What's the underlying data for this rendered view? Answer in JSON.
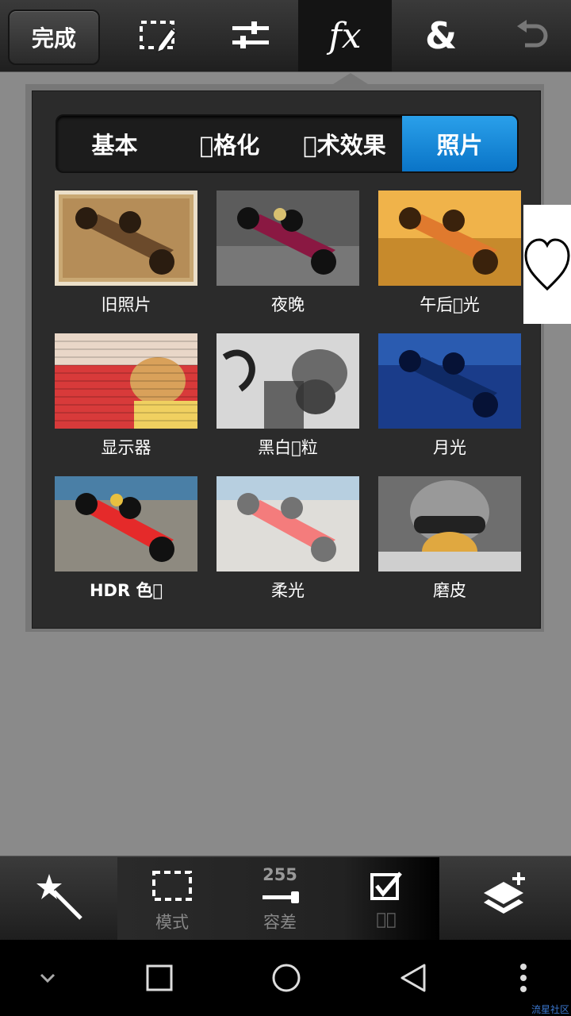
{
  "topbar": {
    "done_label": "完成",
    "tools": [
      {
        "name": "selection-edit-icon"
      },
      {
        "name": "adjust-sliders-icon"
      },
      {
        "name": "fx",
        "label": "fx"
      },
      {
        "name": "ampersand",
        "label": "&"
      },
      {
        "name": "undo-icon"
      }
    ]
  },
  "tabs": [
    {
      "label": "基本",
      "active": false
    },
    {
      "label": "\u0000格化",
      "active": false
    },
    {
      "label": "\u0000术效果",
      "active": false
    },
    {
      "label": "照片",
      "active": true
    }
  ],
  "effects": [
    {
      "label": "旧照片"
    },
    {
      "label": "夜晚"
    },
    {
      "label": "午后\u0000光"
    },
    {
      "label": "显示器"
    },
    {
      "label": "黑白\u0000粒"
    },
    {
      "label": "月光"
    },
    {
      "label": "HDR 色\u0000"
    },
    {
      "label": "柔光"
    },
    {
      "label": "磨皮"
    }
  ],
  "bottombar": {
    "mode_label": "模式",
    "tolerance_value": "255",
    "tolerance_label": "容差",
    "check_label": "\u0000\u0000"
  },
  "watermark": "流星社区"
}
